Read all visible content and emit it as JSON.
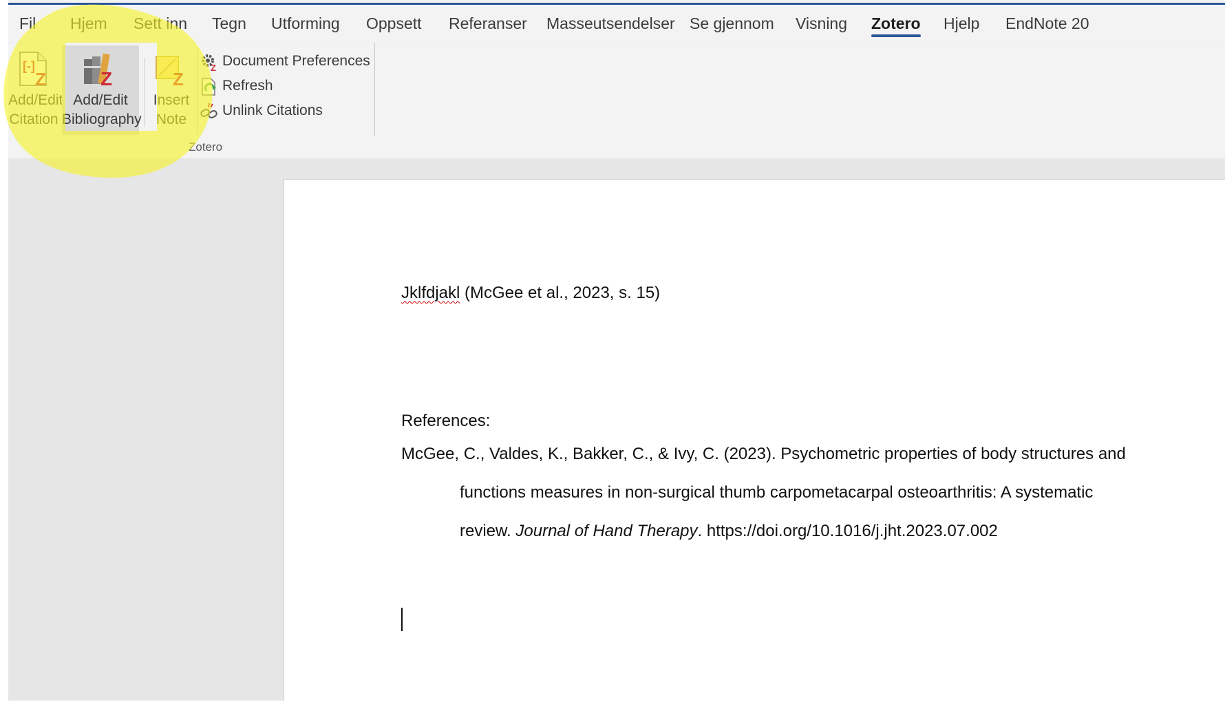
{
  "ribbon_tabs": [
    "Fil",
    "Hjem",
    "Sett inn",
    "Tegn",
    "Utforming",
    "Oppsett",
    "Referanser",
    "Masseutsendelser",
    "Se gjennom",
    "Visning",
    "Zotero",
    "Hjelp",
    "EndNote 20"
  ],
  "active_tab": "Zotero",
  "zotero_group": {
    "label": "Zotero",
    "add_edit_citation": {
      "line1": "Add/Edit",
      "line2": "Citation"
    },
    "add_edit_bibliography": {
      "line1": "Add/Edit",
      "line2": "Bibliography"
    },
    "insert_note": {
      "line1": "Insert",
      "line2": "Note"
    },
    "document_preferences": "Document Preferences",
    "refresh": "Refresh",
    "unlink_citations": "Unlink Citations"
  },
  "document": {
    "line1_word": "Jklfdjakl",
    "line1_citation": " (McGee et al., 2023, s. 15)",
    "references_heading": "References:",
    "ref_line1": "McGee, C., Valdes, K., Bakker, C., & Ivy, C. (2023). Psychometric properties of body structures and",
    "ref_line2": "functions measures in non-surgical thumb carpometacarpal osteoarthritis: A systematic",
    "ref_line3_pre": "review. ",
    "ref_line3_journal": "Journal of Hand Therapy",
    "ref_line3_post": ". https://doi.org/10.1016/j.jht.2023.07.002"
  },
  "colors": {
    "accent": "#2b579a",
    "highlight": "#f5f227",
    "zotero_red": "#cc2936"
  }
}
